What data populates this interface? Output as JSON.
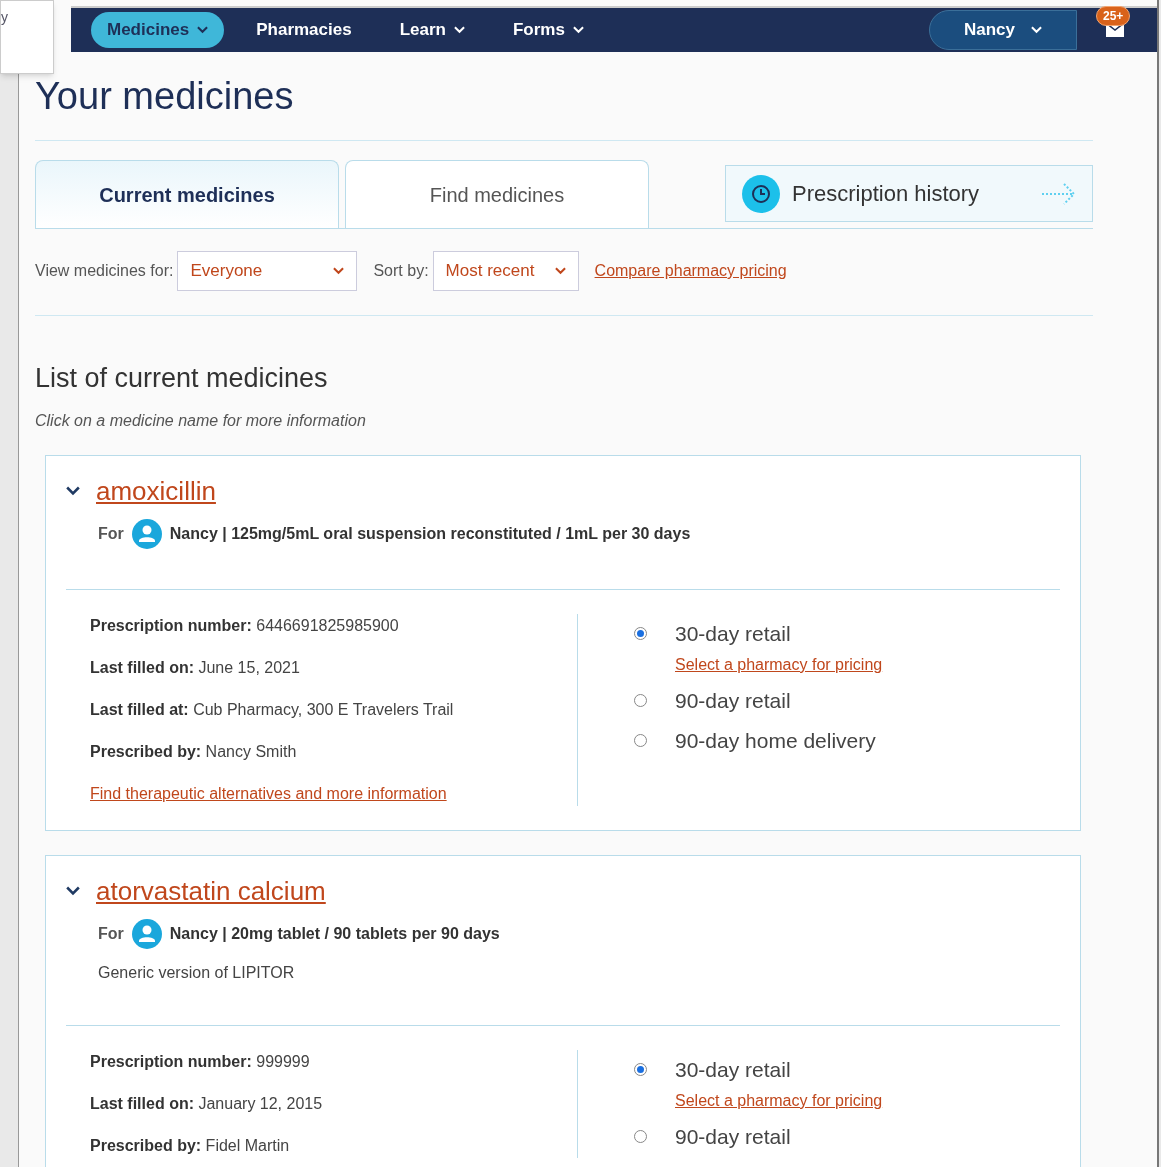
{
  "overlay_window": {
    "text": "y"
  },
  "nav": {
    "items": [
      {
        "label": "Medicines",
        "selected": true,
        "dropdown": true
      },
      {
        "label": "Pharmacies",
        "selected": false,
        "dropdown": false
      },
      {
        "label": "Learn",
        "selected": false,
        "dropdown": true
      },
      {
        "label": "Forms",
        "selected": false,
        "dropdown": true
      }
    ],
    "user": "Nancy",
    "badge": "25+"
  },
  "title": "Your medicines",
  "tabs": [
    {
      "label": "Current medicines",
      "selected": true
    },
    {
      "label": "Find medicines",
      "selected": false
    }
  ],
  "history_link": "Prescription history",
  "filters": {
    "view_label": "View medicines for:",
    "view_value": "Everyone",
    "sort_label": "Sort by:",
    "sort_value": "Most recent",
    "compare_link": "Compare pharmacy pricing"
  },
  "list_title": "List of current medicines",
  "list_hint": "Click on a medicine name for more information",
  "medicines": [
    {
      "name": "amoxicillin",
      "expanded": true,
      "for_label": "For",
      "detail": "Nancy | 125mg/5mL oral suspension reconstituted / 1mL per 30 days",
      "fields": [
        {
          "label": "Prescription number:",
          "value": "6446691825985900"
        },
        {
          "label": "Last filled on:",
          "value": "June 15, 2021"
        },
        {
          "label": "Last filled at:",
          "value": "Cub Pharmacy, 300 E Travelers Trail"
        },
        {
          "label": "Prescribed by:",
          "value": "Nancy Smith"
        }
      ],
      "more_link": "Find therapeutic alternatives and more information",
      "options": [
        {
          "label": "30-day retail",
          "selected": true,
          "pricing_link": "Select a pharmacy for pricing"
        },
        {
          "label": "90-day retail",
          "selected": false
        },
        {
          "label": "90-day home delivery",
          "selected": false
        }
      ]
    },
    {
      "name": "atorvastatin calcium",
      "expanded": true,
      "for_label": "For",
      "detail": "Nancy | 20mg tablet / 90 tablets per 90 days",
      "note": "Generic version of LIPITOR",
      "fields": [
        {
          "label": "Prescription number:",
          "value": "999999"
        },
        {
          "label": "Last filled on:",
          "value": "January 12, 2015"
        },
        {
          "label": "Prescribed by:",
          "value": "Fidel Martin"
        }
      ],
      "options": [
        {
          "label": "30-day retail",
          "selected": true,
          "pricing_link": "Select a pharmacy for pricing"
        },
        {
          "label": "90-day retail",
          "selected": false
        }
      ]
    }
  ]
}
